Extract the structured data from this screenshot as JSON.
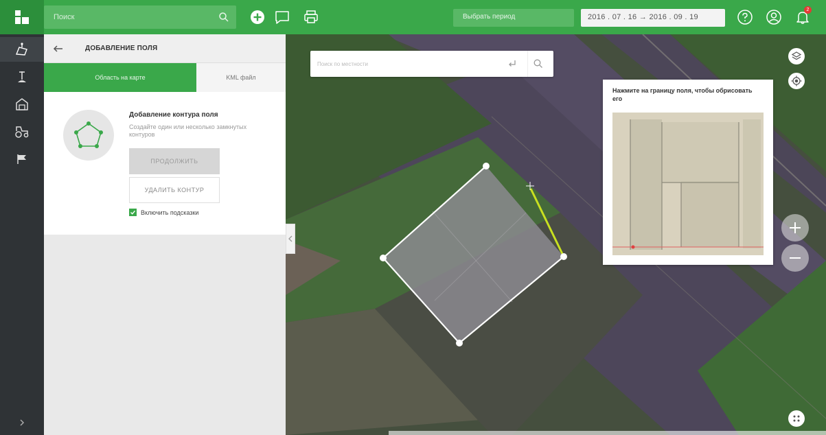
{
  "header": {
    "search_placeholder": "Поиск",
    "period_label": "Выбрать период",
    "date_range": "2016 . 07 . 16  →  2016 . 09 . 19",
    "notification_count": "2"
  },
  "panel": {
    "title": "ДОБАВЛЕНИЕ ПОЛЯ",
    "tabs": [
      {
        "label": "Область на карте",
        "active": true
      },
      {
        "label": "KML файл",
        "active": false
      }
    ],
    "contour_title": "Добавление контура поля",
    "contour_desc": "Создайте один или несколько замкнутых контуров",
    "continue_label": "ПРОДОЛЖИТЬ",
    "delete_label": "УДАЛИТЬ КОНТУР",
    "hints_label": "Включить подсказки",
    "hints_checked": true
  },
  "map": {
    "search_placeholder": "Поиск по местности",
    "hint_text": "Нажмите на границу поля, чтобы обрисовать его"
  },
  "colors": {
    "brand_green": "#3aa84a",
    "rail_dark": "#2f3336",
    "trace_line": "#c8e020"
  }
}
